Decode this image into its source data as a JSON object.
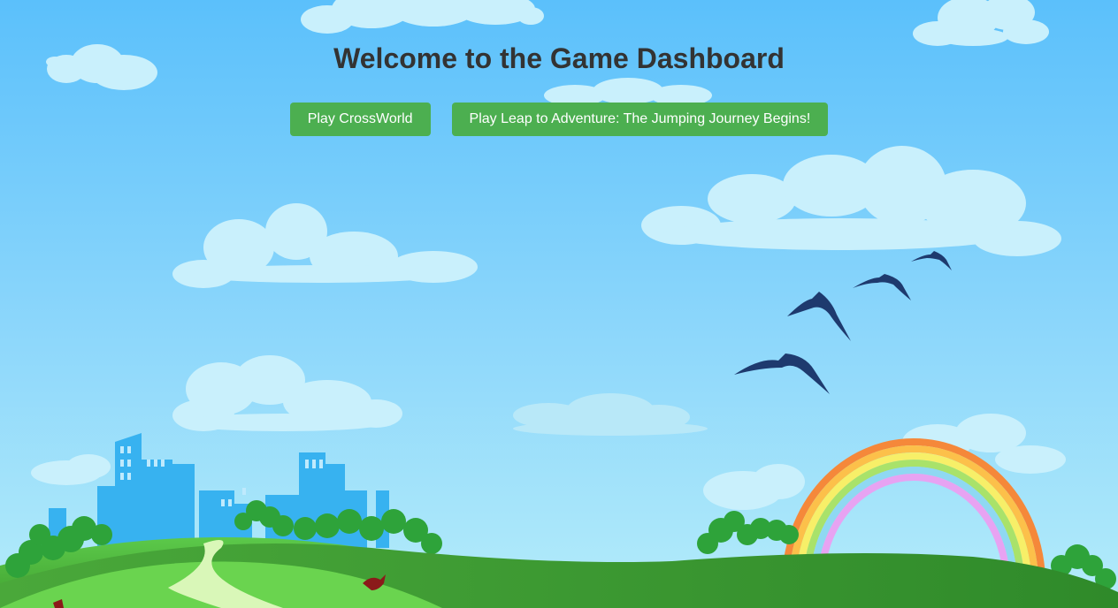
{
  "page": {
    "title": "Welcome to the Game Dashboard"
  },
  "games": [
    {
      "label": "Play CrossWorld"
    },
    {
      "label": "Play Leap to Adventure: The Jumping Journey Begins!"
    }
  ],
  "colors": {
    "sky_top": "#5bc0fb",
    "sky_bottom": "#b4ecfa",
    "cloud": "#c9f0fc",
    "button": "#4caf50",
    "hill": "#4cb33c",
    "city": "#37b2f0",
    "bird": "#1e3a6e"
  }
}
